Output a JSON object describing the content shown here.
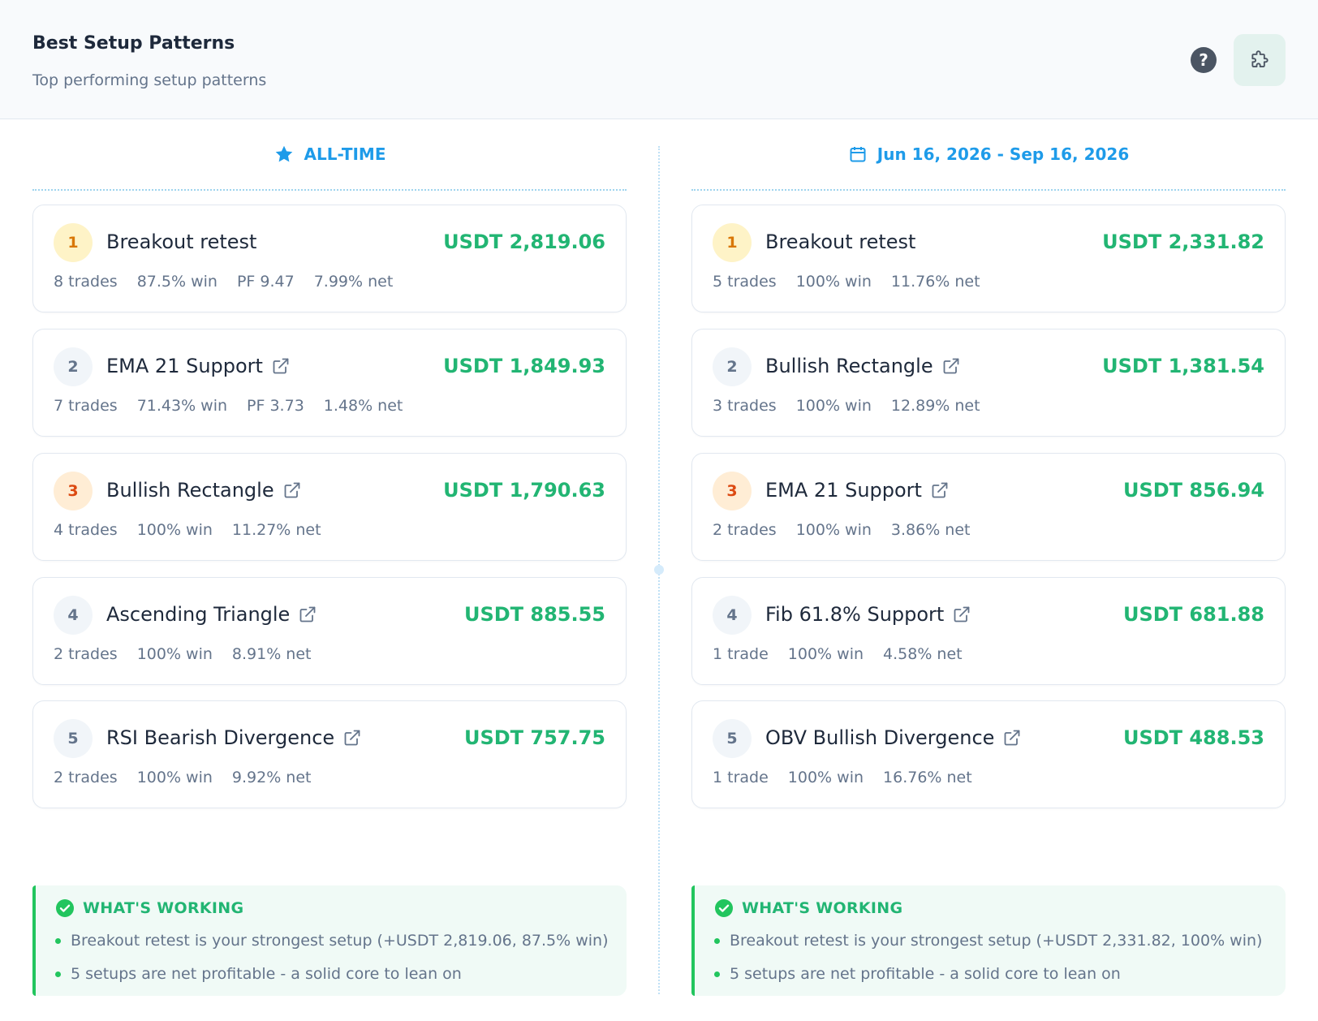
{
  "header": {
    "title": "Best Setup Patterns",
    "subtitle": "Top performing setup patterns",
    "help_label": "?",
    "help_icon": "help-circle-icon",
    "settings_icon": "puzzle-icon"
  },
  "colors": {
    "accent": "#1e9be9",
    "profit": "#22b573",
    "gold": "#d97706",
    "bronze": "#dc4a12"
  },
  "columns": [
    {
      "label": "ALL-TIME",
      "icon": "star-icon",
      "setups": [
        {
          "rank": "1",
          "name": "Breakout retest",
          "value": "USDT 2,819.06",
          "stats": [
            "8 trades",
            "87.5% win",
            "PF 9.47",
            "7.99% net"
          ],
          "link": false
        },
        {
          "rank": "2",
          "name": "EMA 21 Support",
          "value": "USDT 1,849.93",
          "stats": [
            "7 trades",
            "71.43% win",
            "PF 3.73",
            "1.48% net"
          ],
          "link": true
        },
        {
          "rank": "3",
          "name": "Bullish Rectangle",
          "value": "USDT 1,790.63",
          "stats": [
            "4 trades",
            "100% win",
            "11.27% net"
          ],
          "link": true
        },
        {
          "rank": "4",
          "name": "Ascending Triangle",
          "value": "USDT 885.55",
          "stats": [
            "2 trades",
            "100% win",
            "8.91% net"
          ],
          "link": true
        },
        {
          "rank": "5",
          "name": "RSI Bearish Divergence",
          "value": "USDT 757.75",
          "stats": [
            "2 trades",
            "100% win",
            "9.92% net"
          ],
          "link": true
        }
      ],
      "working": {
        "title": "WHAT'S WORKING",
        "items": [
          "Breakout retest is your strongest setup (+USDT 2,819.06, 87.5% win)",
          "5 setups are net profitable - a solid core to lean on"
        ]
      }
    },
    {
      "label": "Jun 16, 2026 - Sep 16, 2026",
      "icon": "calendar-icon",
      "setups": [
        {
          "rank": "1",
          "name": "Breakout retest",
          "value": "USDT 2,331.82",
          "stats": [
            "5 trades",
            "100% win",
            "11.76% net"
          ],
          "link": false
        },
        {
          "rank": "2",
          "name": "Bullish Rectangle",
          "value": "USDT 1,381.54",
          "stats": [
            "3 trades",
            "100% win",
            "12.89% net"
          ],
          "link": true
        },
        {
          "rank": "3",
          "name": "EMA 21 Support",
          "value": "USDT 856.94",
          "stats": [
            "2 trades",
            "100% win",
            "3.86% net"
          ],
          "link": true
        },
        {
          "rank": "4",
          "name": "Fib 61.8% Support",
          "value": "USDT 681.88",
          "stats": [
            "1 trade",
            "100% win",
            "4.58% net"
          ],
          "link": true
        },
        {
          "rank": "5",
          "name": "OBV Bullish Divergence",
          "value": "USDT 488.53",
          "stats": [
            "1 trade",
            "100% win",
            "16.76% net"
          ],
          "link": true
        }
      ],
      "working": {
        "title": "WHAT'S WORKING",
        "items": [
          "Breakout retest is your strongest setup (+USDT 2,331.82, 100% win)",
          "5 setups are net profitable - a solid core to lean on"
        ]
      }
    }
  ]
}
